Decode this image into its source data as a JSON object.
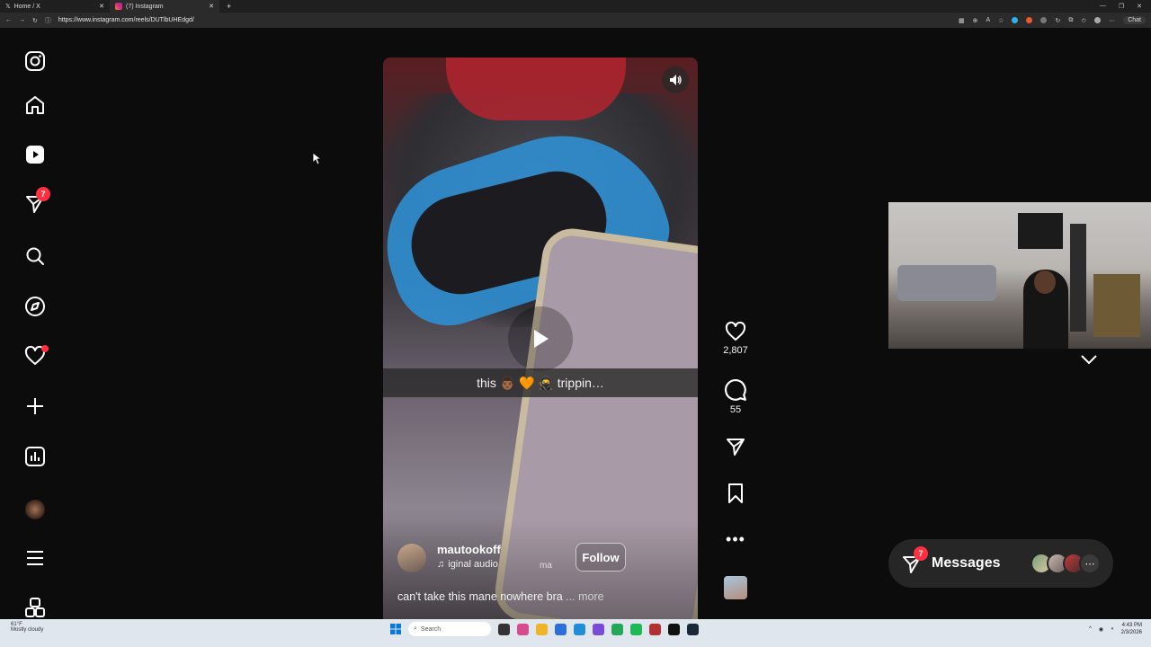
{
  "browser": {
    "tabs": [
      {
        "title": "Home / X",
        "active": false
      },
      {
        "title": "(7) Instagram",
        "active": true
      }
    ],
    "url": "https://www.instagram.com/reels/DUTlbUHEdgd/",
    "chat_label": "Chat"
  },
  "sidebar": {
    "items": [
      {
        "name": "instagram-logo-icon"
      },
      {
        "name": "home-icon"
      },
      {
        "name": "reels-icon"
      },
      {
        "name": "messages-icon",
        "badge": "7"
      },
      {
        "name": "search-icon"
      },
      {
        "name": "explore-icon"
      },
      {
        "name": "notifications-icon",
        "dot": true
      },
      {
        "name": "create-icon"
      },
      {
        "name": "dashboard-icon"
      },
      {
        "name": "profile-icon"
      },
      {
        "name": "more-icon"
      },
      {
        "name": "also-from-meta-icon"
      }
    ]
  },
  "reel": {
    "caption_overlay": "this 👨🏾 🧡 🥷 trippin…",
    "username": "mautookoff",
    "audio": "iginal audio",
    "audio_extra": "ma",
    "follow_label": "Follow",
    "description": "can't take this mane nowhere bra",
    "more_label": "... more"
  },
  "actions": {
    "likes": "2,807",
    "comments": "55"
  },
  "messages": {
    "label": "Messages",
    "badge": "7"
  },
  "taskbar": {
    "weather_temp": "61°F",
    "weather_desc": "Mostly cloudy",
    "search_placeholder": "Search",
    "time": "4:43 PM",
    "date": "2/3/2026"
  },
  "colors": {
    "background": "#0c0c0d",
    "badge": "#ff3040",
    "messages_pill": "#262626"
  }
}
